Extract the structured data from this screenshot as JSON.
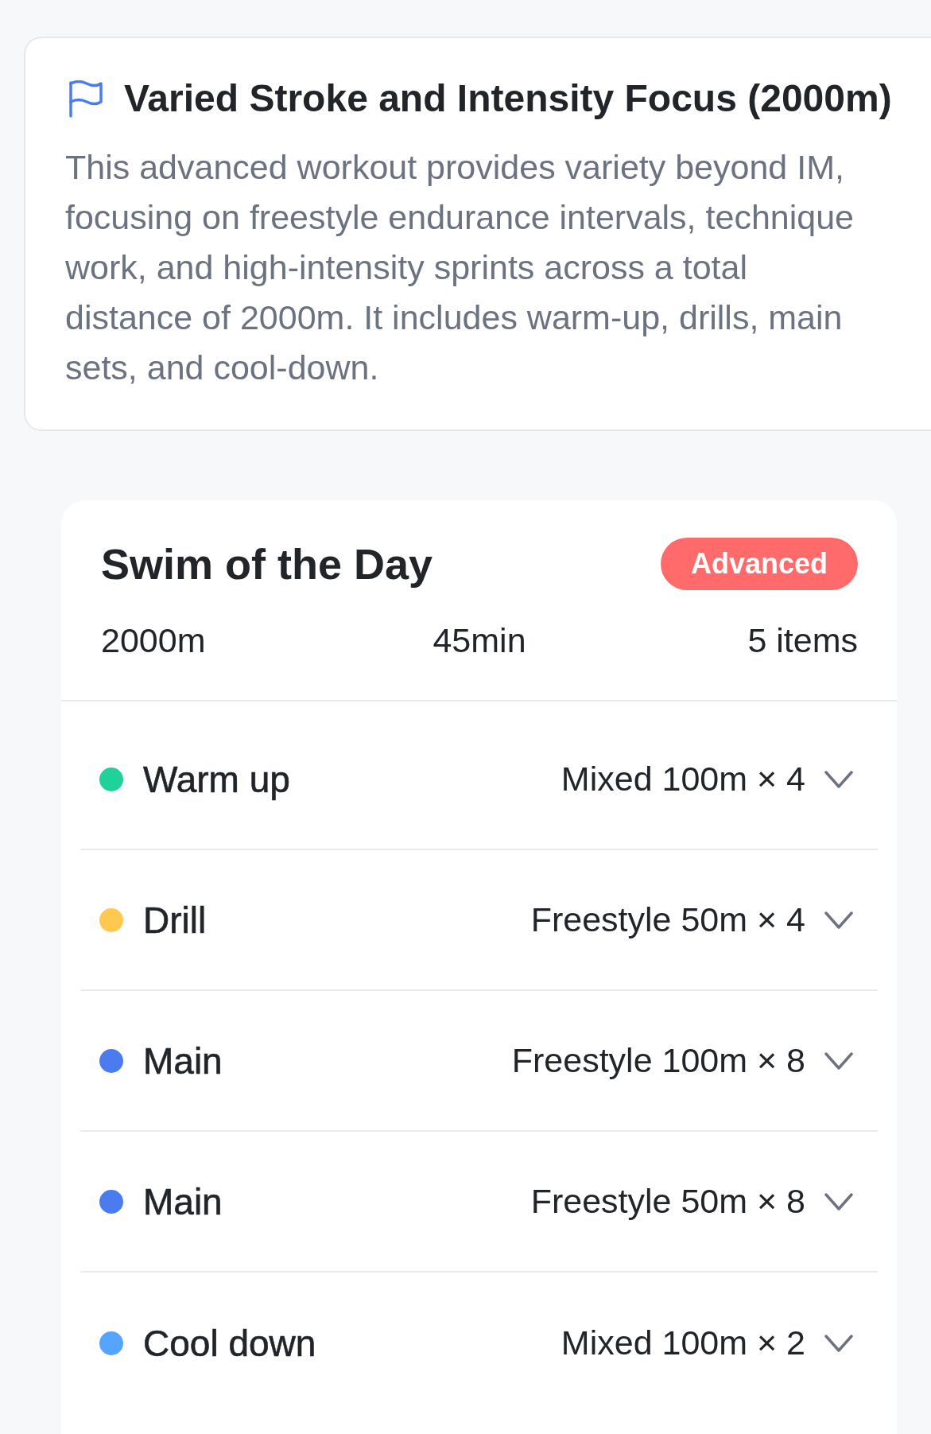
{
  "summary": {
    "title": "Varied Stroke and Intensity Focus (2000m)",
    "description": "This advanced workout provides variety beyond IM, focusing on freestyle endurance intervals, technique work, and high-intensity sprints across a total distance of 2000m. It includes warm-up, drills, main sets, and cool-down."
  },
  "swim_card": {
    "title": "Swim of the Day",
    "level_badge": "Advanced",
    "stats": [
      "2000m",
      "45min",
      "5 items"
    ],
    "items": [
      {
        "name": "Warm up",
        "detail": "Mixed 100m × 4",
        "color": "#20d19a",
        "expanded": false
      },
      {
        "name": "Drill",
        "detail": "Freestyle 50m × 4",
        "color": "#ffc94f",
        "expanded": false
      },
      {
        "name": "Main",
        "detail": "Freestyle 100m × 8",
        "color": "#4a7cf0",
        "expanded": false
      },
      {
        "name": "Main",
        "detail": "Freestyle 50m × 8",
        "color": "#4a7cf0",
        "expanded": false
      },
      {
        "name": "Cool down",
        "detail": "Mixed 100m × 2",
        "color": "#55a5ff",
        "expanded": false
      }
    ]
  }
}
